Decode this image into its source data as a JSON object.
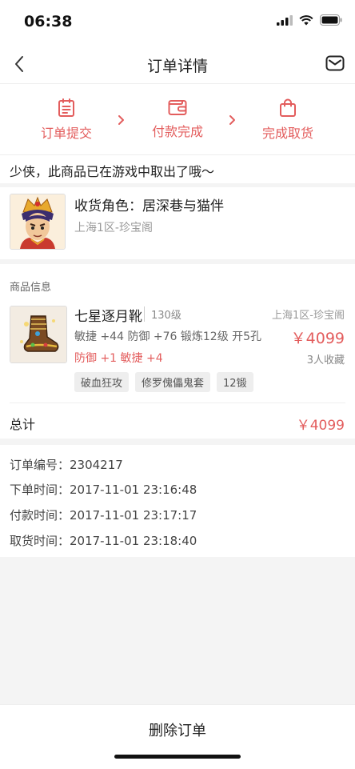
{
  "status_bar": {
    "time": "06:38"
  },
  "nav": {
    "title": "订单详情"
  },
  "steps": [
    {
      "label": "订单提交",
      "icon": "clipboard-icon"
    },
    {
      "label": "付款完成",
      "icon": "wallet-icon"
    },
    {
      "label": "完成取货",
      "icon": "shopping-bag-icon"
    }
  ],
  "notice": "少侠，此商品已在游戏中取出了哦～",
  "role": {
    "name": "收货角色：居深巷与猫伴",
    "server": "上海1区-珍宝阁"
  },
  "goods": {
    "section_title": "商品信息",
    "name": "七星逐月靴",
    "level": "130级",
    "server": "上海1区-珍宝阁",
    "attr1": "敏捷 +44 防御 +76 锻炼12级 开5孔",
    "attr2": "防御 +1 敏捷 +4",
    "price": "￥4099",
    "favorites": "3人收藏",
    "tags": [
      "破血狂攻",
      "修罗傀儡鬼套",
      "12锻"
    ]
  },
  "total": {
    "label": "总计",
    "value": "￥4099"
  },
  "order": {
    "number": "订单编号：2304217",
    "order_time": "下单时间：2017-11-01 23:16:48",
    "pay_time": "付款时间：2017-11-01 23:17:17",
    "pickup_time": "取货时间：2017-11-01 23:18:40"
  },
  "actions": {
    "delete": "删除订单"
  },
  "colors": {
    "accent": "#e35d5d",
    "background": "#f4f4f4"
  }
}
